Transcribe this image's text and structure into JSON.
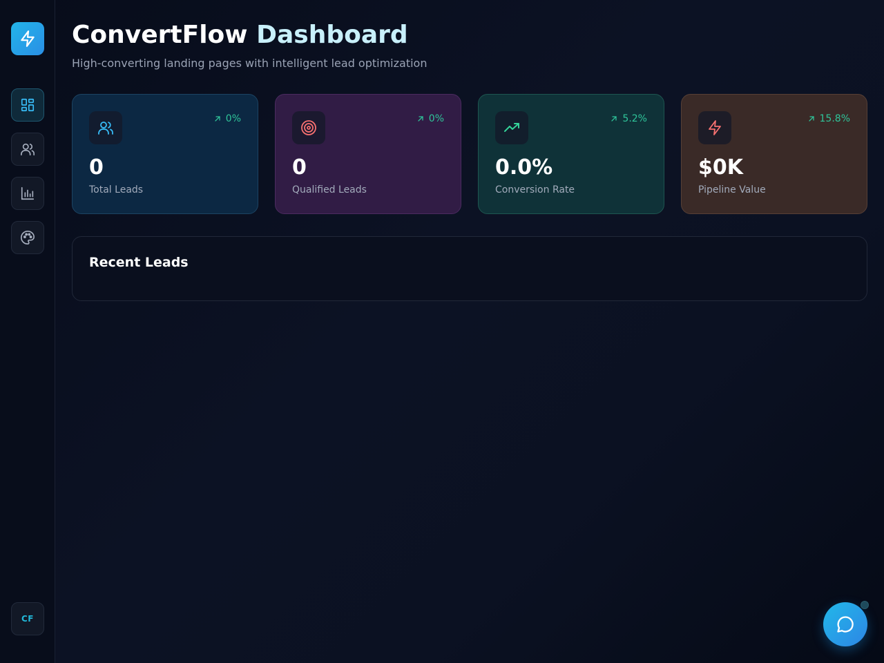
{
  "app": {
    "title_part1": "ConvertFlow",
    "title_part2": "Dashboard",
    "subtitle": "High-converting landing pages with intelligent lead optimization"
  },
  "sidebar": {
    "logo_icon": "lightning-icon",
    "items": [
      {
        "name": "dashboard",
        "icon": "dashboard-icon",
        "active": true
      },
      {
        "name": "leads",
        "icon": "users-icon",
        "active": false
      },
      {
        "name": "analytics",
        "icon": "bar-chart-icon",
        "active": false
      },
      {
        "name": "themes",
        "icon": "palette-icon",
        "active": false
      }
    ],
    "avatar_initials": "CF"
  },
  "stats": [
    {
      "label": "Total Leads",
      "value": "0",
      "trend": "0%",
      "icon": "users-icon",
      "color": "#38bdf8"
    },
    {
      "label": "Qualified Leads",
      "value": "0",
      "trend": "0%",
      "icon": "target-icon",
      "color": "#f87171"
    },
    {
      "label": "Conversion Rate",
      "value": "0.0%",
      "trend": "5.2%",
      "icon": "trending-up-icon",
      "color": "#34d399"
    },
    {
      "label": "Pipeline Value",
      "value": "$0K",
      "trend": "15.8%",
      "icon": "lightning-icon",
      "color": "#f87171"
    }
  ],
  "recent_leads": {
    "title": "Recent Leads"
  },
  "chat": {
    "icon": "chat-bubble-icon"
  },
  "colors": {
    "accent": "#22b4e8",
    "trend_positive": "#2fc59a"
  }
}
